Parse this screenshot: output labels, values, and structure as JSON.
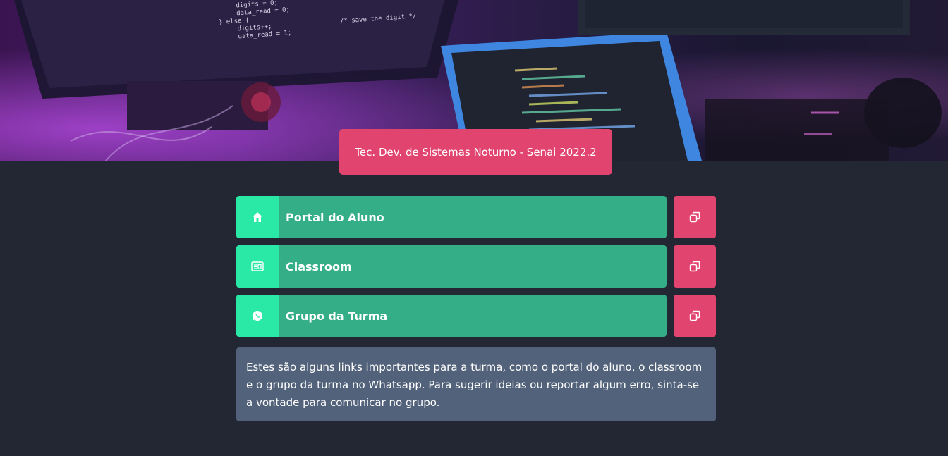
{
  "header": {
    "title": "Tec. Dev. de Sistemas Noturno - Senai 2022.2",
    "code_lines": [
      "digits = 0;",
      "data_read = 0;",
      "} else {",
      "digits++;",
      "data_read = 1;",
      "/* save the digit */"
    ]
  },
  "links": [
    {
      "label": "Portal do Aluno",
      "icon": "home-icon"
    },
    {
      "label": "Classroom",
      "icon": "classroom-icon"
    },
    {
      "label": "Grupo da Turma",
      "icon": "whatsapp-icon"
    }
  ],
  "copy_icon": "copy-icon",
  "info": {
    "text": "Estes são alguns links importantes para a turma, como o portal do aluno, o classroom e o grupo da turma no Whatsapp. Para sugerir ideias ou reportar algum erro, sinta-se a vontade para comunicar no grupo."
  },
  "colors": {
    "background": "#222733",
    "accent_pink": "#e1456f",
    "link_green": "#34ae86",
    "icon_green": "#2ae8a6",
    "info_box": "#52627a"
  }
}
